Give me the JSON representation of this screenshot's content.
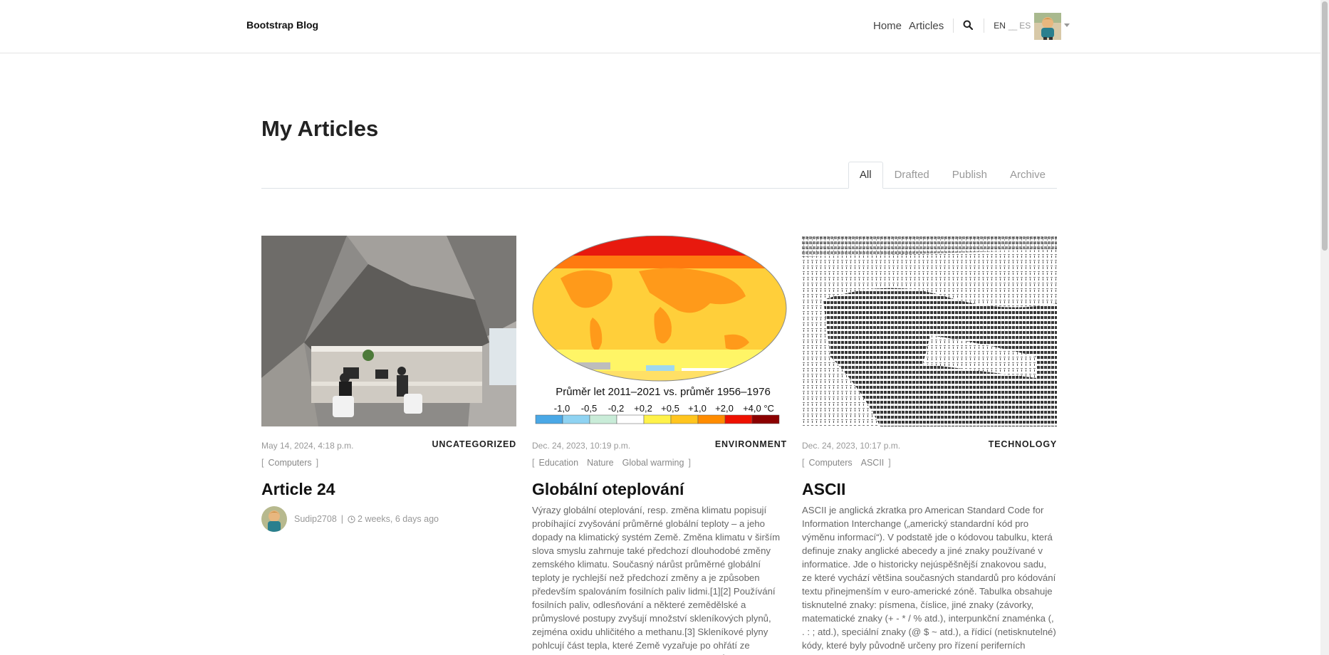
{
  "nav": {
    "brand": "Bootstrap Blog",
    "links": [
      "Home",
      "Articles"
    ],
    "lang_en": "EN",
    "lang_dash": "__",
    "lang_es": "ES"
  },
  "page": {
    "title": "My Articles"
  },
  "tabs": [
    "All",
    "Drafted",
    "Publish",
    "Archive"
  ],
  "articles": [
    {
      "date": "May 14, 2024, 4:18 p.m.",
      "category": "UNCATEGORIZED",
      "tags": [
        "Computers"
      ],
      "title": "Article 24",
      "author": "Sudip2708",
      "byline_sep": "|",
      "time_ago": "2 weeks, 6 days ago"
    },
    {
      "date": "Dec. 24, 2023, 10:19 p.m.",
      "category": "ENVIRONMENT",
      "tags": [
        "Education",
        "Nature",
        "Global warming"
      ],
      "title": "Globální oteplování",
      "excerpt": "Výrazy globální oteplování, resp. změna klimatu popisují probíhající zvyšování průměrné globální teploty – a jeho dopady na klimatický systém Země. Změna klimatu v širším slova smyslu zahrnuje také předchozí dlouhodobé změny zemského klimatu. Současný nárůst průměrné globální teploty je rychlejší než předchozí změny a je způsoben především spalováním fosilních paliv lidmi.[1][2] Používání fosilních paliv, odlesňování a některé zemědělské a průmyslové postupy zvyšují množství skleníkových plynů, zejména oxidu uhličitého a methanu.[3] Skleníkové plyny pohlcují část tepla, které Země vyzařuje po ohřátí ze slunečního záření. Větší množství těchto plynů zachycuje více",
      "image": {
        "caption": "Průměr let 2011–2021 vs. průměr 1956–1976",
        "scale": [
          "-1,0",
          "-0,5",
          "-0,2",
          "+0,2",
          "+0,5",
          "+1,0",
          "+2,0",
          "+4,0 °C"
        ],
        "scale_colors": [
          "#4aa8e6",
          "#8fd3f2",
          "#c9ecd8",
          "#ffffff",
          "#fff24a",
          "#ffc51e",
          "#ff8c00",
          "#ee1100",
          "#8b0000"
        ]
      }
    },
    {
      "date": "Dec. 24, 2023, 10:17 p.m.",
      "category": "TECHNOLOGY",
      "tags": [
        "Computers",
        "ASCII"
      ],
      "title": "ASCII",
      "excerpt": "ASCII je anglická zkratka pro American Standard Code for Information Interchange („americký standardní kód pro výměnu informací“). V podstatě jde o kódovou tabulku, která definuje znaky anglické abecedy a jiné znaky používané v informatice. Jde o historicky nejúspěšnější znakovou sadu, ze které vychází většina současných standardů pro kódování textu přinejmenším v euro-americké zóně. Tabulka obsahuje tisknutelné znaky: písmena, číslice, jiné znaky (závorky, matematické znaky (+ - * / % atd.), interpunkční znaménka (, . : ; atd.), speciální znaky (@ $ ~ atd.), a řídicí (netisknutelné) kódy, které byly původně určeny pro řízení periferních zařízení (např. tiskárny nebo dálnopisu)."
    }
  ]
}
